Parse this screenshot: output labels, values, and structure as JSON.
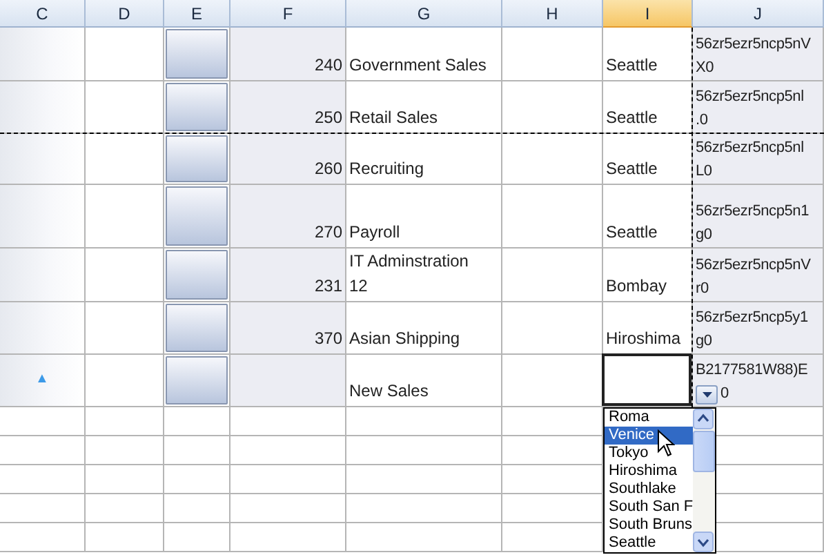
{
  "columns": [
    {
      "label": "C",
      "selected": false
    },
    {
      "label": "D",
      "selected": false
    },
    {
      "label": "E",
      "selected": false
    },
    {
      "label": "F",
      "selected": false
    },
    {
      "label": "G",
      "selected": false
    },
    {
      "label": "H",
      "selected": false
    },
    {
      "label": "I",
      "selected": true
    },
    {
      "label": "J",
      "selected": false
    }
  ],
  "rows": [
    {
      "number": "240",
      "name": "Government Sales",
      "city": "Seattle",
      "code": "56zr5ezr5ncp5nV\nX0",
      "editing": false
    },
    {
      "number": "250",
      "name": "Retail Sales",
      "city": "Seattle",
      "code": "56zr5ezr5ncp5nl\n.0",
      "editing": false
    },
    {
      "number": "260",
      "name": "Recruiting",
      "city": "Seattle",
      "code": "56zr5ezr5ncp5nl\nL0",
      "editing": false
    },
    {
      "number": "270",
      "name": "Payroll",
      "city": "Seattle",
      "code": "56zr5ezr5ncp5n1\ng0",
      "editing": false
    },
    {
      "number": "231",
      "name": "IT Adminstration\n12",
      "city": "Bombay",
      "code": "56zr5ezr5ncp5nV\nr0",
      "editing": false
    },
    {
      "number": "370",
      "name": "Asian Shipping",
      "city": "Hiroshima",
      "code": "56zr5ezr5ncp5y1\ng0",
      "editing": false
    },
    {
      "marker": "▲",
      "name": "New Sales",
      "city": "",
      "code": "B2177581W88)E",
      "code_tail": "0",
      "editing": true
    }
  ],
  "dropdown": {
    "items": [
      {
        "label": "Roma",
        "selected": false
      },
      {
        "label": "Venice",
        "selected": true
      },
      {
        "label": "Tokyo",
        "selected": false
      },
      {
        "label": "Hiroshima",
        "selected": false
      },
      {
        "label": "Southlake",
        "selected": false
      },
      {
        "label": "South San F",
        "selected": false
      },
      {
        "label": "South Bruns",
        "selected": false
      },
      {
        "label": "Seattle",
        "selected": false
      }
    ]
  }
}
